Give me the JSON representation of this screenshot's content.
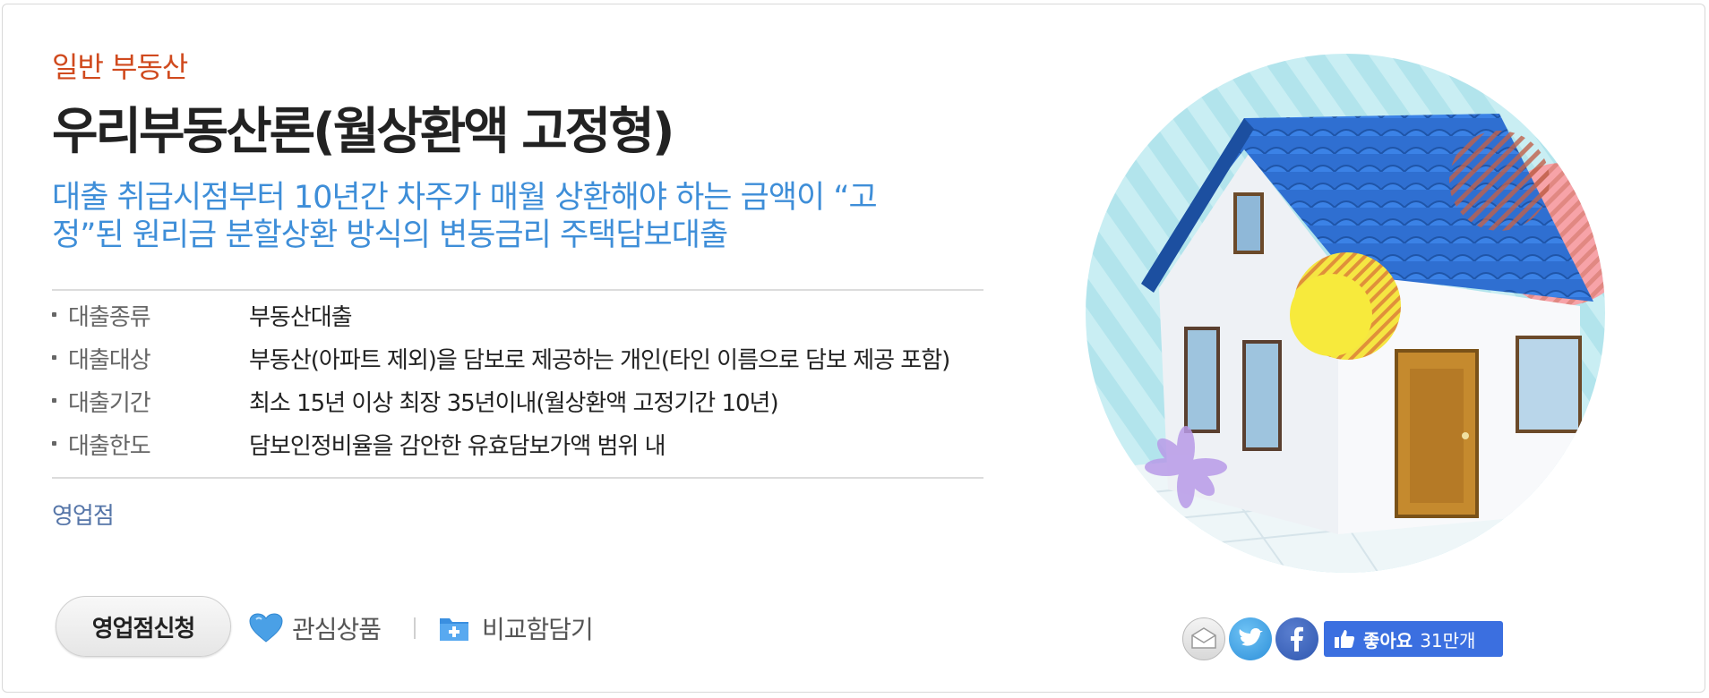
{
  "product": {
    "category": "일반 부동산",
    "title": "우리부동산론(월상환액 고정형)",
    "description_line1": "대출 취급시점부터 10년간 차주가 매월 상환해야 하는 금액이 “고",
    "description_line2": "정”된 원리금 분할상환 방식의 변동금리 주택담보대출"
  },
  "info": [
    {
      "label": "대출종류",
      "value": "부동산대출"
    },
    {
      "label": "대출대상",
      "value": "부동산(아파트 제외)을 담보로 제공하는 개인(타인 이름으로 담보 제공 포함)"
    },
    {
      "label": "대출기간",
      "value": "최소 15년 이상 최장 35년이내(월상환액 고정기간 10년)"
    },
    {
      "label": "대출한도",
      "value": "담보인정비율을 감안한 유효담보가액 범위 내"
    }
  ],
  "branch_label": "영업점",
  "actions": {
    "apply_label": "영업점신청",
    "favorite_label": "관심상품",
    "compare_label": "비교함담기"
  },
  "share": {
    "icons": [
      "email-icon",
      "twitter-icon",
      "facebook-icon"
    ],
    "like_label": "좋아요",
    "like_count": "31만개"
  },
  "colors": {
    "category": "#d04a1e",
    "description": "#3e8ed8",
    "branch": "#5575a8",
    "like_button": "#3b6fe0",
    "roof": "#2f6fd1"
  }
}
